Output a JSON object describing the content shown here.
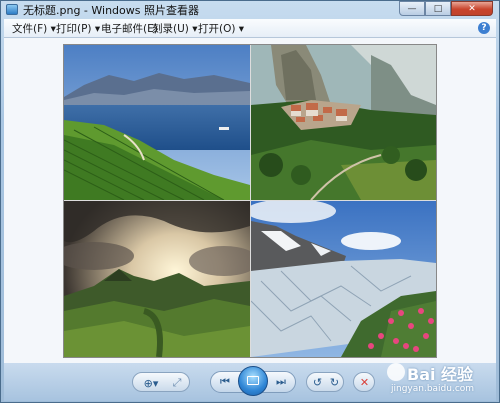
{
  "window": {
    "title": "无标题.png - Windows 照片查看器",
    "minimize_glyph": "—",
    "maximize_glyph": "□",
    "close_glyph": "✕"
  },
  "menu": {
    "items": [
      {
        "label": "文件(F) ▾"
      },
      {
        "label": "打印(P) ▾"
      },
      {
        "label": "电子邮件(E)"
      },
      {
        "label": "刻录(U) ▾"
      },
      {
        "label": "打开(O) ▾"
      }
    ],
    "help_glyph": "?"
  },
  "photos": [
    {
      "name": "vineyard-lake-tile"
    },
    {
      "name": "cliff-village-tile"
    },
    {
      "name": "valley-clouds-tile"
    },
    {
      "name": "glacier-flowers-tile"
    }
  ],
  "controls": {
    "zoom_glyph": "⊕▾",
    "actual_size_glyph": "⤢",
    "previous_glyph": "⏮",
    "next_glyph": "⏭",
    "rotate_ccw_glyph": "↺",
    "rotate_cw_glyph": "↻",
    "delete_glyph": "✕"
  },
  "watermark": {
    "brand": "Bai 经验",
    "url": "jingyan.baidu.com"
  },
  "colors": {
    "accent": "#2f86d6",
    "close_button": "#c9452d",
    "delete_icon": "#d9403a"
  }
}
